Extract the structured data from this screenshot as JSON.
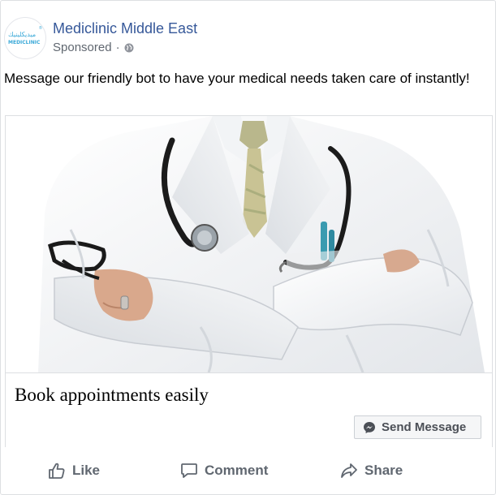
{
  "page": {
    "name": "Mediclinic Middle East",
    "sponsored_label": "Sponsored",
    "separator": "·",
    "logo": {
      "arabic_text": "ميديكلينيك",
      "latin_text": "MEDICLINIC",
      "trademark": "®"
    }
  },
  "post": {
    "text": "Message our friendly bot to have your medical needs taken care of instantly!"
  },
  "card": {
    "image_icon": "doctor-in-white-coat-image",
    "headline": "Book appointments easily",
    "cta_label": "Send Message",
    "cta_icon": "messenger-icon"
  },
  "actions": [
    {
      "label": "Like",
      "icon": "thumbs-up-icon"
    },
    {
      "label": "Comment",
      "icon": "comment-bubble-icon"
    },
    {
      "label": "Share",
      "icon": "share-arrow-icon"
    }
  ],
  "colors": {
    "page_name": "#365899",
    "meta_gray": "#606770",
    "logo_blue": "#3aa9d8",
    "border": "#dddfe2",
    "button_bg": "#f5f6f7"
  }
}
